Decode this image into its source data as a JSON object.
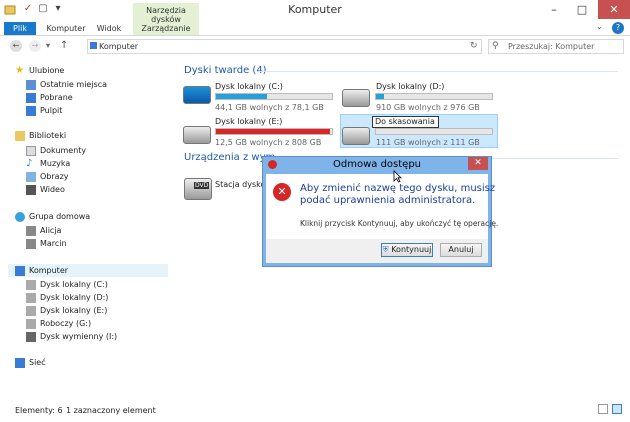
{
  "window": {
    "title": "Komputer",
    "minimize": "–",
    "maximize": "□",
    "close": "✕"
  },
  "quick_access": {
    "properties": "✓",
    "new_folder": "▢",
    "dropdown": "▾"
  },
  "ribbon": {
    "context_group": "Narzędzia dysków",
    "tabs": [
      "Plik",
      "Komputer",
      "Widok",
      "Zarządzanie"
    ],
    "help": "?",
    "expand": "⌄"
  },
  "nav": {
    "back": "←",
    "forward": "→",
    "history": "▾",
    "up": "↑"
  },
  "address": {
    "path": "Komputer",
    "refresh": "↻"
  },
  "search": {
    "placeholder": "Przeszukaj: Komputer",
    "icon": "⚲"
  },
  "sidebar": {
    "favorites": {
      "label": "Ulubione",
      "items": [
        "Ostatnie miejsca",
        "Pobrane",
        "Pulpit"
      ]
    },
    "libraries": {
      "label": "Biblioteki",
      "items": [
        "Dokumenty",
        "Muzyka",
        "Obrazy",
        "Wideo"
      ]
    },
    "homegroup": {
      "label": "Grupa domowa",
      "items": [
        "Alicja",
        "Marcin"
      ]
    },
    "computer": {
      "label": "Komputer",
      "items": [
        "Dysk lokalny (C:)",
        "Dysk lokalny (D:)",
        "Dysk lokalny (E:)",
        "Roboczy (G:)",
        "Dysk wymienny (I:)"
      ]
    },
    "network": {
      "label": "Sieć"
    }
  },
  "content": {
    "hard_drives_header": "Dyski twarde (4)",
    "removable_header": "Urządzenia z wym",
    "drives": [
      {
        "name": "Dysk lokalny (C:)",
        "free": "44,1 GB wolnych z 78,1 GB",
        "used_fraction": 0.44,
        "color": "#26a0da"
      },
      {
        "name": "Dysk lokalny (D:)",
        "free": "910 GB wolnych z 976 GB",
        "used_fraction": 0.07,
        "color": "#26a0da"
      },
      {
        "name": "Dysk lokalny (E:)",
        "free": "12,5 GB wolnych z 808 GB",
        "used_fraction": 0.98,
        "color": "#da2626"
      },
      {
        "name": "Do skasowania",
        "free": "111 GB wolnych z 111 GB",
        "used_fraction": 0.0,
        "color": "#26a0da"
      }
    ],
    "dvd": {
      "name": "Stacja dysków",
      "badge": "DVD"
    }
  },
  "status": {
    "count": "Elementy: 6",
    "selected": "1 zaznaczony element"
  },
  "dialog": {
    "title": "Odmowa dostępu",
    "close": "✕",
    "message_line1": "Aby zmienić nazwę tego dysku, musisz",
    "message_line2": "podać uprawnienia administratora.",
    "hint": "Kliknij przycisk Kontynuuj, aby ukończyć tę operację.",
    "continue_label": "Kontynuuj",
    "cancel_label": "Anuluj",
    "error_glyph": "✕",
    "shield_glyph": "⛨"
  },
  "colors": {
    "accent": "#1979ca",
    "selection": "#cce8ff",
    "dialog_frame": "#7eb4ea"
  }
}
